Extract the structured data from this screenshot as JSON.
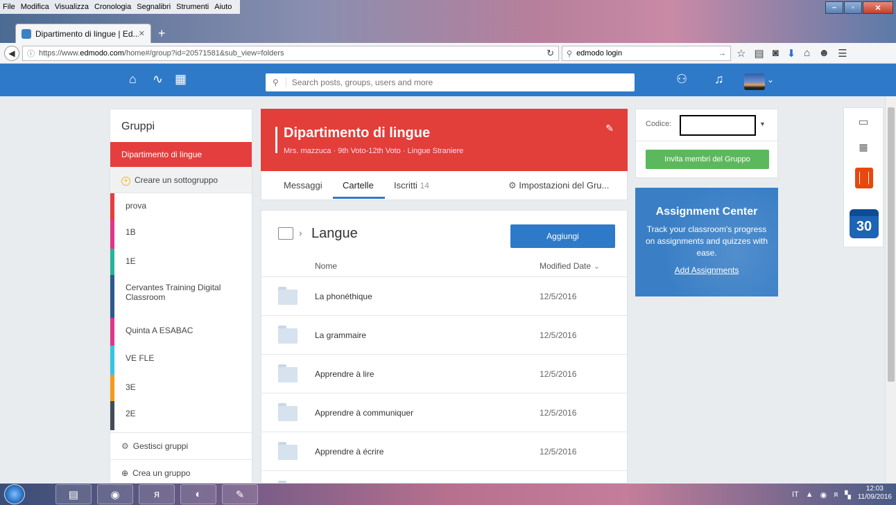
{
  "firefox": {
    "menu": [
      "File",
      "Modifica",
      "Visualizza",
      "Cronologia",
      "Segnalibri",
      "Strumenti",
      "Aiuto"
    ],
    "tab_title": "Dipartimento di lingue | Ed...",
    "url_prefix": "https://www.",
    "url_domain": "edmodo.com",
    "url_rest": "/home#/group?id=20571581&sub_view=folders",
    "search_value": "edmodo login"
  },
  "header": {
    "search_placeholder": "Search posts, groups, users and more"
  },
  "sidebar": {
    "title": "Gruppi",
    "active": "Dipartimento di lingue",
    "create_sub": "Creare un sottogruppo",
    "groups": [
      {
        "label": "prova",
        "color": "#e53e3e"
      },
      {
        "label": "1B",
        "color": "#e0358a"
      },
      {
        "label": "1E",
        "color": "#2ab29a"
      },
      {
        "label": "Cervantes Training Digital Classroom",
        "color": "#2c5a8c"
      },
      {
        "label": "Quinta A ESABAC",
        "color": "#e0358a"
      },
      {
        "label": "VE FLE",
        "color": "#38c4e0"
      },
      {
        "label": "3E",
        "color": "#f39b1f"
      },
      {
        "label": "2E",
        "color": "#444b55"
      }
    ],
    "manage": "Gestisci gruppi",
    "create_group": "Crea un gruppo"
  },
  "group": {
    "name": "Dipartimento di lingue",
    "meta": "Mrs. mazzuca · 9th Voto-12th Voto · Lingue Straniere",
    "tabs": {
      "messages": "Messaggi",
      "folders": "Cartelle",
      "members": "Iscritti",
      "members_count": "14",
      "settings": "Impostazioni del Gru..."
    }
  },
  "files": {
    "folder": "Langue",
    "add_label": "Aggiungi",
    "col_name": "Nome",
    "col_date": "Modified Date",
    "rows": [
      {
        "name": "La phonéthique",
        "date": "12/5/2016"
      },
      {
        "name": "La grammaire",
        "date": "12/5/2016"
      },
      {
        "name": "Apprendre à lire",
        "date": "12/5/2016"
      },
      {
        "name": "Apprendre à communiquer",
        "date": "12/5/2016"
      },
      {
        "name": "Apprendre à écrire",
        "date": "12/5/2016"
      }
    ]
  },
  "code_card": {
    "label": "Codice:",
    "invite": "Invita membri del Gruppo"
  },
  "assignment": {
    "title": "Assignment Center",
    "desc": "Track your classroom's progress on assignments and quizzes with ease.",
    "link": "Add Assignments"
  },
  "apps": {
    "calendar_day": "30"
  },
  "taskbar": {
    "lang": "IT",
    "time": "12:03",
    "date": "11/09/2016"
  }
}
